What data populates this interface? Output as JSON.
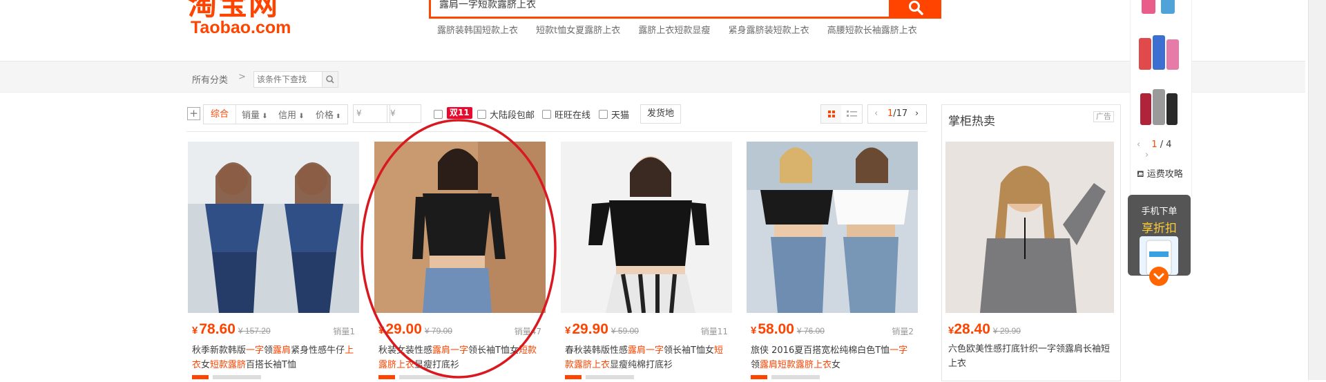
{
  "header": {
    "logo_cn": "淘宝网",
    "logo_en": "Taobao.com",
    "search_value": "露肩一字短款露脐上衣",
    "hot_words": [
      "露脐装韩国短款上衣",
      "短款t恤女夏露脐上衣",
      "露脐上衣短款显瘦",
      "紧身露脐装短款上衣",
      "高腰短款长袖露脐上衣"
    ]
  },
  "nav": {
    "all_categories": "所有分类",
    "arrow": ">",
    "filter_placeholder": "该条件下查找"
  },
  "filter": {
    "plus": "+",
    "sort_zonghe": "综合",
    "sort_sales": "销量",
    "sort_credit": "信用",
    "sort_price": "价格",
    "price_min": "¥",
    "price_max": "¥",
    "badge_11": "双11",
    "opt_free_ship": "大陆段包邮",
    "opt_wangwang": "旺旺在线",
    "opt_tmall": "天猫",
    "ship_from": "发货地",
    "page_current": "1",
    "page_total": "/17"
  },
  "products": [
    {
      "price": "78.60",
      "old_price": "¥ 157.20",
      "sold": "销量1",
      "title_parts": [
        [
          "秋季新款韩版",
          0
        ],
        [
          "一字",
          1
        ],
        [
          "领",
          0
        ],
        [
          "露肩",
          1
        ],
        [
          "紧身性感牛仔",
          0
        ],
        [
          "上衣",
          1
        ],
        [
          "女",
          0
        ],
        [
          "短款露脐",
          1
        ],
        [
          "百搭长袖T恤",
          0
        ]
      ]
    },
    {
      "price": "29.00",
      "old_price": "¥ 79.00",
      "sold": "销量47",
      "title_parts": [
        [
          "秋装女装性感",
          0
        ],
        [
          "露肩一字",
          1
        ],
        [
          "领长袖T恤女",
          0
        ],
        [
          "短款露脐上衣",
          1
        ],
        [
          "显瘦打底衫",
          0
        ]
      ]
    },
    {
      "price": "29.90",
      "old_price": "¥ 59.00",
      "sold": "销量11",
      "title_parts": [
        [
          "春秋装韩版性感",
          0
        ],
        [
          "露肩一字",
          1
        ],
        [
          "领长袖T恤女",
          0
        ],
        [
          "短款露脐上衣",
          1
        ],
        [
          "显瘦纯棉打底衫",
          0
        ]
      ]
    },
    {
      "price": "58.00",
      "old_price": "¥ 76.00",
      "sold": "销量2",
      "title_parts": [
        [
          "旅侠 2016夏百搭宽松纯棉白色T恤",
          0
        ],
        [
          "一字",
          1
        ],
        [
          "领",
          0
        ],
        [
          "露肩短款露脐上衣",
          1
        ],
        [
          "女",
          0
        ]
      ]
    }
  ],
  "hot_panel": {
    "title": "掌柜热卖",
    "ad": "广告",
    "price": "28.40",
    "old_price": "¥ 29.90",
    "item_title": "六色欧美性感打底针织一字领露肩长袖短上衣"
  },
  "side": {
    "pager_current": "1",
    "pager_total": " / 4",
    "shipping_guide": "运费攻略",
    "phone_line1": "手机下单",
    "phone_line2": "享折扣"
  },
  "colors": {
    "brand": "#ff4400",
    "highlight": "#ff4400",
    "badge": "#e60b2e",
    "annotation": "#d9191f"
  },
  "icons": {
    "search": "magnifier-icon",
    "annotation": "red-circle-annotation"
  }
}
